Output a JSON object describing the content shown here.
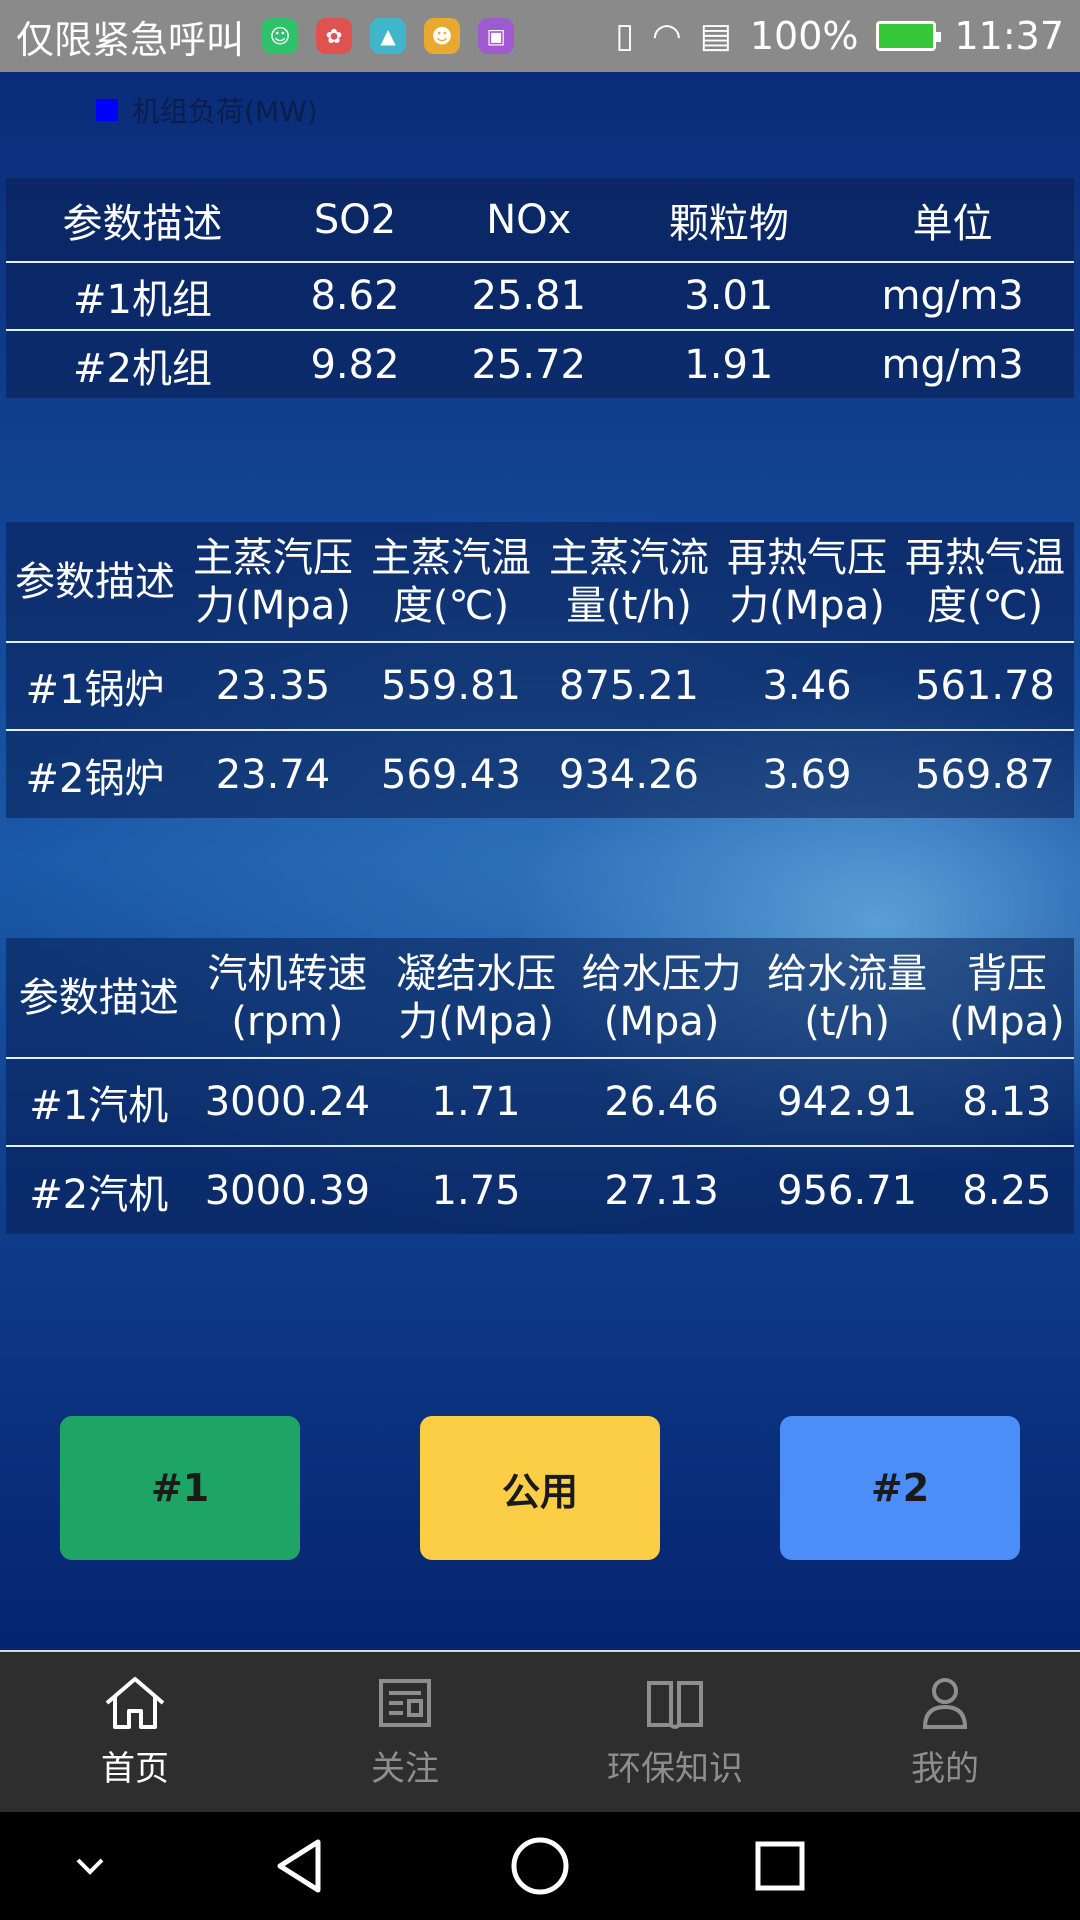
{
  "status_bar": {
    "carrier": "仅限紧急呼叫",
    "battery": "100%",
    "time": "11:37"
  },
  "legend": {
    "label": "机组负荷(MW)",
    "color": "#0000ff"
  },
  "emission_table": {
    "headers": [
      "参数描述",
      "SO2",
      "NOx",
      "颗粒物",
      "单位"
    ],
    "rows": [
      [
        "#1机组",
        "8.62",
        "25.81",
        "3.01",
        "mg/m3"
      ],
      [
        "#2机组",
        "9.82",
        "25.72",
        "1.91",
        "mg/m3"
      ]
    ]
  },
  "boiler_table": {
    "headers": [
      [
        "参数描述",
        ""
      ],
      [
        "主蒸汽压",
        "力(Mpa)"
      ],
      [
        "主蒸汽温",
        "度(℃)"
      ],
      [
        "主蒸汽流",
        "量(t/h)"
      ],
      [
        "再热气压",
        "力(Mpa)"
      ],
      [
        "再热气温",
        "度(℃)"
      ]
    ],
    "rows": [
      [
        "#1锅炉",
        "23.35",
        "559.81",
        "875.21",
        "3.46",
        "561.78"
      ],
      [
        "#2锅炉",
        "23.74",
        "569.43",
        "934.26",
        "3.69",
        "569.87"
      ]
    ]
  },
  "turbine_table": {
    "headers": [
      [
        "参数描述",
        ""
      ],
      [
        "汽机转速",
        "(rpm)"
      ],
      [
        "凝结水压",
        "力(Mpa)"
      ],
      [
        "给水压力",
        "(Mpa)"
      ],
      [
        "给水流量",
        "(t/h)"
      ],
      [
        "背压",
        "(Mpa)"
      ]
    ],
    "rows": [
      [
        "#1汽机",
        "3000.24",
        "1.71",
        "26.46",
        "942.91",
        "8.13"
      ],
      [
        "#2汽机",
        "3000.39",
        "1.75",
        "27.13",
        "956.71",
        "8.25"
      ]
    ]
  },
  "buttons": {
    "unit1": "#1",
    "common": "公用",
    "unit2": "#2"
  },
  "colors": {
    "unit1_button": "#1ea566",
    "common_button": "#fcce45",
    "unit2_button": "#4c8ef7"
  },
  "tabs": [
    {
      "label": "首页",
      "icon": "home-icon",
      "active": true
    },
    {
      "label": "关注",
      "icon": "news-icon",
      "active": false
    },
    {
      "label": "环保知识",
      "icon": "book-icon",
      "active": false
    },
    {
      "label": "我的",
      "icon": "user-icon",
      "active": false
    }
  ]
}
